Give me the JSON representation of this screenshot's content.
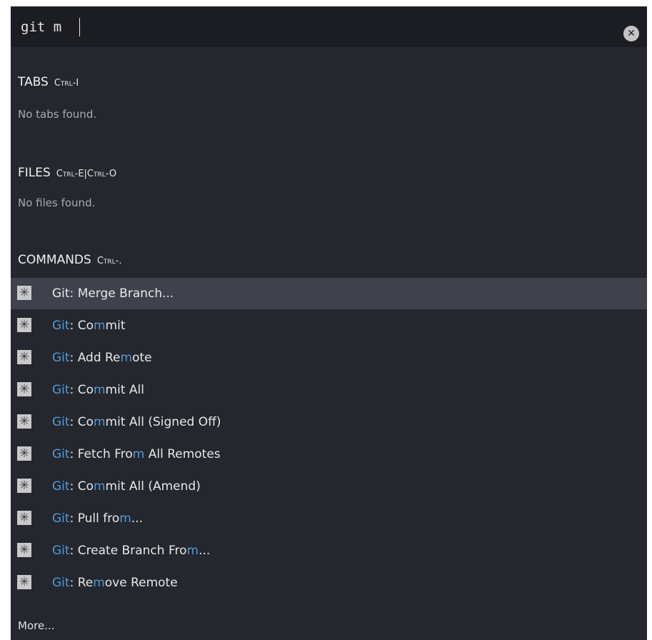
{
  "search": {
    "value": "git m",
    "clear_icon": "close-icon"
  },
  "sections": {
    "tabs": {
      "title": "TABS",
      "shortcut": "Ctrl-I",
      "empty": "No tabs found."
    },
    "files": {
      "title": "FILES",
      "shortcut": "Ctrl-E|Ctrl-O",
      "empty": "No files found."
    },
    "commands": {
      "title": "COMMANDS",
      "shortcut": "Ctrl-.",
      "icon": "command-icon",
      "highlight_color": "#4f9ad8",
      "selected_index": 0,
      "items": [
        {
          "label": "Git: Merge Branch...",
          "segments": [
            {
              "t": "Git: Merge Branch...",
              "h": false
            }
          ]
        },
        {
          "label": "Git: Commit",
          "segments": [
            {
              "t": "Git",
              "h": true
            },
            {
              "t": ": Co",
              "h": false
            },
            {
              "t": "m",
              "h": true
            },
            {
              "t": "mit",
              "h": false
            }
          ]
        },
        {
          "label": "Git: Add Remote",
          "segments": [
            {
              "t": "Git",
              "h": true
            },
            {
              "t": ": Add Re",
              "h": false
            },
            {
              "t": "m",
              "h": true
            },
            {
              "t": "ote",
              "h": false
            }
          ]
        },
        {
          "label": "Git: Commit All",
          "segments": [
            {
              "t": "Git",
              "h": true
            },
            {
              "t": ": Co",
              "h": false
            },
            {
              "t": "m",
              "h": true
            },
            {
              "t": "mit All",
              "h": false
            }
          ]
        },
        {
          "label": "Git: Commit All (Signed Off)",
          "segments": [
            {
              "t": "Git",
              "h": true
            },
            {
              "t": ": Co",
              "h": false
            },
            {
              "t": "m",
              "h": true
            },
            {
              "t": "mit All (Signed Off)",
              "h": false
            }
          ]
        },
        {
          "label": "Git: Fetch From All Remotes",
          "segments": [
            {
              "t": "Git",
              "h": true
            },
            {
              "t": ": Fetch Fro",
              "h": false
            },
            {
              "t": "m",
              "h": true
            },
            {
              "t": " All Remotes",
              "h": false
            }
          ]
        },
        {
          "label": "Git: Commit All (Amend)",
          "segments": [
            {
              "t": "Git",
              "h": true
            },
            {
              "t": ": Co",
              "h": false
            },
            {
              "t": "m",
              "h": true
            },
            {
              "t": "mit All (Amend)",
              "h": false
            }
          ]
        },
        {
          "label": "Git: Pull from...",
          "segments": [
            {
              "t": "Git",
              "h": true
            },
            {
              "t": ": Pull fro",
              "h": false
            },
            {
              "t": "m",
              "h": true
            },
            {
              "t": "...",
              "h": false
            }
          ]
        },
        {
          "label": "Git: Create Branch From...",
          "segments": [
            {
              "t": "Git",
              "h": true
            },
            {
              "t": ": Create Branch Fro",
              "h": false
            },
            {
              "t": "m",
              "h": true
            },
            {
              "t": "...",
              "h": false
            }
          ]
        },
        {
          "label": "Git: Remove Remote",
          "segments": [
            {
              "t": "Git",
              "h": true
            },
            {
              "t": ": Re",
              "h": false
            },
            {
              "t": "m",
              "h": true
            },
            {
              "t": "ove Remote",
              "h": false
            }
          ]
        }
      ]
    }
  },
  "more_label": "More..."
}
